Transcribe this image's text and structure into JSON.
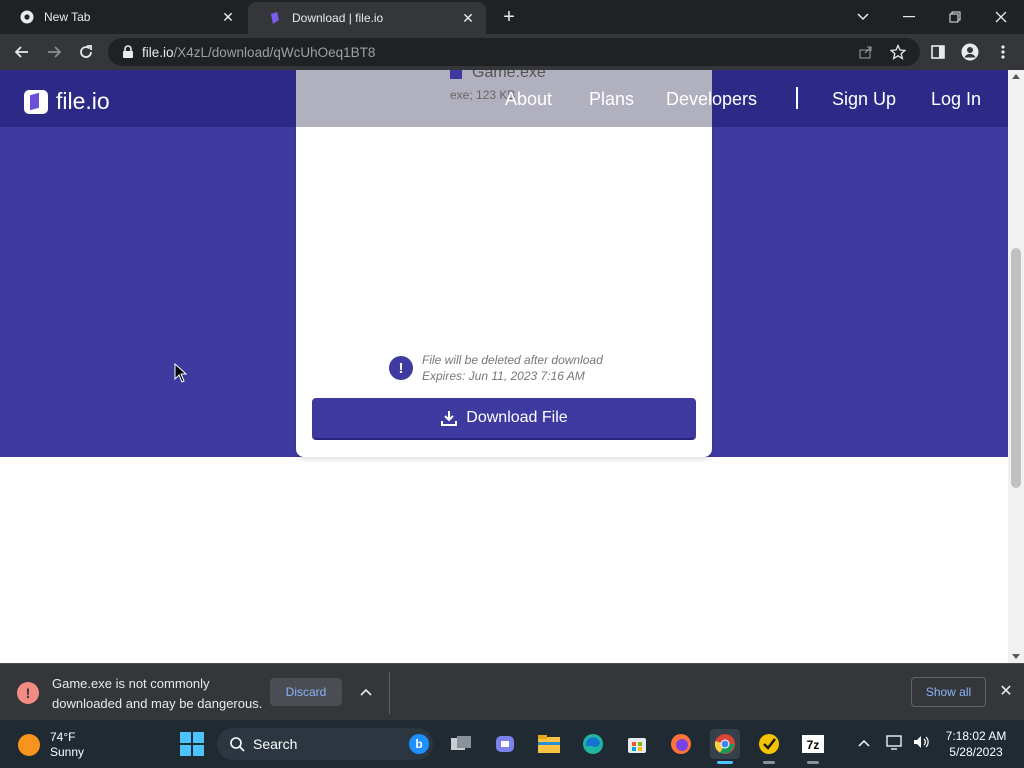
{
  "browser": {
    "tabs": [
      {
        "title": "New Tab",
        "icon": "chrome-icon",
        "active": false
      },
      {
        "title": "Download | file.io",
        "icon": "fileio-favicon",
        "active": true
      }
    ],
    "url_host": "file.io",
    "url_path": "/X4zL/download/qWcUhOeq1BT8"
  },
  "site": {
    "logo_text": "file.io",
    "nav": {
      "about": "About",
      "plans": "Plans",
      "developers": "Developers",
      "signup": "Sign Up",
      "login": "Log In"
    },
    "file": {
      "name": "Game.exe",
      "meta": "exe; 123 KB"
    },
    "notice_line1": "File will be deleted after download",
    "notice_line2": "Expires: Jun 11, 2023 7:16 AM",
    "download_label": "Download File",
    "colors": {
      "brand": "#3f3aa0",
      "nav_bg": "#2d2a87"
    }
  },
  "download_shelf": {
    "warning": "Game.exe is not commonly downloaded and may be dangerous.",
    "discard": "Discard",
    "show_all": "Show all"
  },
  "taskbar": {
    "weather_temp": "74°F",
    "weather_desc": "Sunny",
    "search_label": "Search",
    "time": "7:18:02 AM",
    "date": "5/28/2023",
    "apps": [
      "task-view-icon",
      "teams-icon",
      "file-explorer-icon",
      "edge-icon",
      "store-icon",
      "firefox-icon",
      "chrome-icon",
      "norton-icon",
      "7zip-icon"
    ]
  }
}
